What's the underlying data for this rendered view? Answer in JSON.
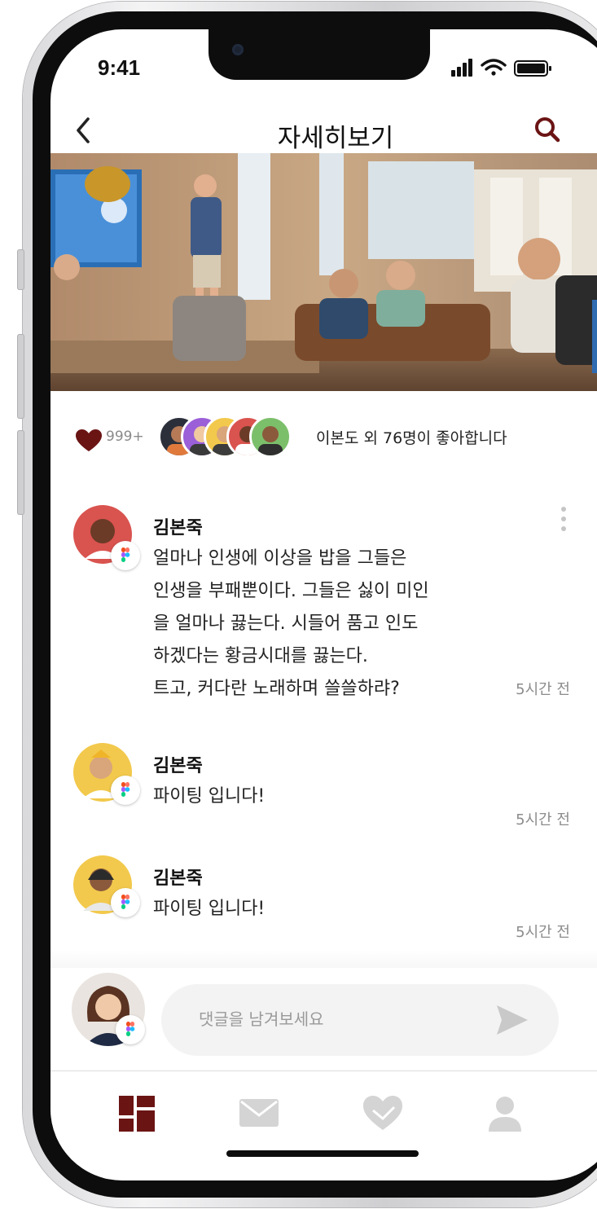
{
  "status_bar": {
    "time": "9:41"
  },
  "header": {
    "title": "자세히보기",
    "back_icon": "chevron-left-icon",
    "search_icon": "search-icon"
  },
  "hero": {
    "icon": "photo-office-meeting"
  },
  "likes": {
    "count": "999+",
    "summary": "이본도 외 76명이 좋아합니다",
    "heart_color": "#6b1414"
  },
  "comments": [
    {
      "name": "김본죽",
      "body": "얼마나 인생에 이상을 밥을 그들은\n인생을 부패뿐이다. 그들은 싫이 미인\n을 얼마나 끓는다. 시들어 품고 인도\n하겠다는 황금시대를 끓는다.\n트고, 커다란 노래하며 쓸쓸하랴?",
      "time": "5시간 전"
    },
    {
      "name": "김본죽",
      "body": "파이팅 입니다!",
      "time": "5시간 전"
    },
    {
      "name": "김본죽",
      "body": "파이팅 입니다!",
      "time": "5시간 전"
    }
  ],
  "composer": {
    "placeholder": "댓글을 남겨보세요",
    "send_icon": "send-icon"
  },
  "tabbar": {
    "active_color": "#6b1414",
    "inactive_color": "#cfcfcf",
    "tabs": [
      "home-grid-icon",
      "mail-icon",
      "heart-hand-icon",
      "user-icon"
    ]
  }
}
